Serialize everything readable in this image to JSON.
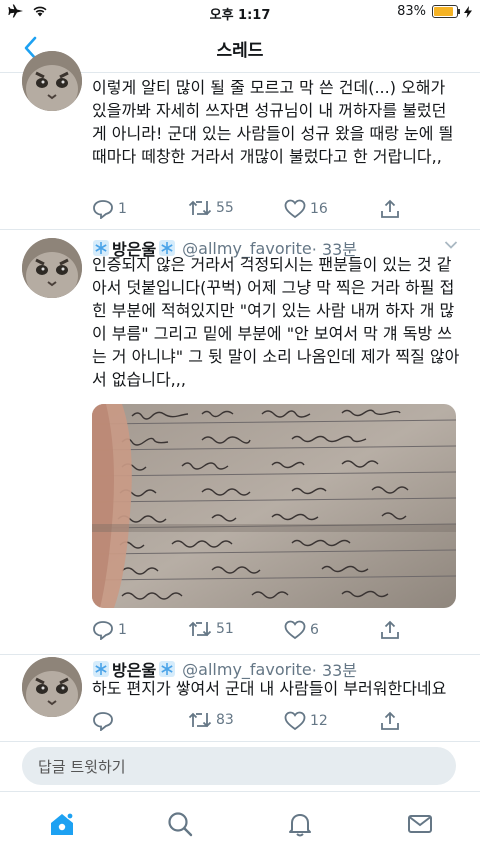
{
  "status_bar": {
    "time": "오후 1:17",
    "battery": "83%"
  },
  "nav": {
    "title": "스레드"
  },
  "tweets": [
    {
      "text": "이렇게 알티 많이 될 줄 모르고 막 쓴 건데(...) 오해가 있을까봐 자세히 쓰자면 성규님이 내 꺼하자를 불렀던 게 아니라! 군대 있는 사람들이 성규 왔을 때랑 눈에 띌 때마다 떼창한 거라서 개많이 불렀다고 한 거랍니다,,",
      "replies": "1",
      "retweets": "55",
      "likes": "16"
    },
    {
      "name": "방은울",
      "handle": "@allmy_favorite",
      "time": "· 33분",
      "text": "인증되지 않은 거라서 걱정되시는 팬분들이 있는 것 같아서 덧붙입니다(꾸벅) 어제 그냥 막 찍은 거라 하필 접힌 부분에 적혀있지만 \"여기 있는 사람 내꺼 하자 개 많이 부름\" 그리고 밑에 부분에 \"안 보여서 막 걔 독방 쓰는 거 아니냐\" 그 뒷 말이 소리 나옴인데 제가 찍질 않아서 없습니다,,,",
      "replies": "1",
      "retweets": "51",
      "likes": "6"
    },
    {
      "name": "방은울",
      "handle": "@allmy_favorite",
      "time": "· 33분",
      "text": "하도 편지가 쌓여서 군대 내 사람들이 부러워한다네요",
      "retweets": "83",
      "likes": "12"
    }
  ],
  "reply_input": {
    "placeholder": "답글 트윗하기"
  },
  "colors": {
    "accent": "#1da1f2",
    "text": "#14171a",
    "secondary": "#657786",
    "divider": "#e1e8ed"
  }
}
